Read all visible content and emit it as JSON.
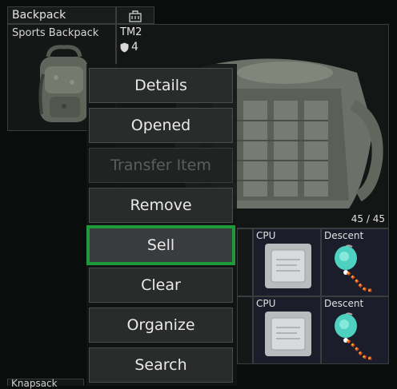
{
  "backpack": {
    "header_label": "Backpack",
    "item_name": "Sports Backpack"
  },
  "armor": {
    "name": "TM2",
    "armor_class": "4",
    "durability": "45 / 45"
  },
  "grid_items": [
    {
      "label": "CPU"
    },
    {
      "label": "Descent"
    },
    {
      "label": "CPU"
    },
    {
      "label": "Descent"
    }
  ],
  "bottom_section": {
    "label": "Knapsack"
  },
  "context_menu": {
    "items": [
      {
        "label": "Details",
        "enabled": true
      },
      {
        "label": "Opened",
        "enabled": true
      },
      {
        "label": "Transfer Item",
        "enabled": false
      },
      {
        "label": "Remove",
        "enabled": true
      },
      {
        "label": "Sell",
        "enabled": true,
        "highlighted": true
      },
      {
        "label": "Clear",
        "enabled": true
      },
      {
        "label": "Organize",
        "enabled": true
      },
      {
        "label": "Search",
        "enabled": true
      }
    ]
  },
  "colors": {
    "highlight": "#1f9a3a",
    "background": "#0b0c0c",
    "item_cell_bg": "#1b1e2a"
  }
}
